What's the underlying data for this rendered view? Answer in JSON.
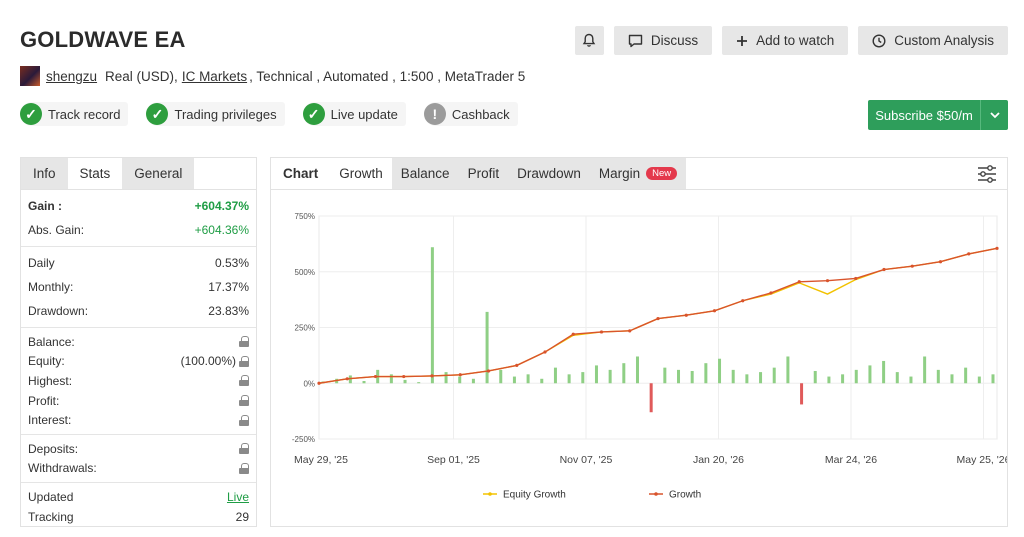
{
  "header": {
    "title": "GOLDWAVE EA",
    "bell_icon": "bell-icon",
    "discuss_label": "Discuss",
    "watch_label": "Add to watch",
    "analysis_label": "Custom Analysis"
  },
  "meta": {
    "author": "shengzu",
    "account_type": "Real (USD),",
    "broker": "IC Markets",
    "details": ", Technical , Automated , 1:500 , MetaTrader 5"
  },
  "badges": [
    {
      "label": "Track record",
      "status": "ok"
    },
    {
      "label": "Trading privileges",
      "status": "ok"
    },
    {
      "label": "Live update",
      "status": "ok"
    },
    {
      "label": "Cashback",
      "status": "unavailable"
    }
  ],
  "subscribe": {
    "label": "Subscribe $50/m"
  },
  "stats_tabs": [
    "Info",
    "Stats",
    "General"
  ],
  "stats": {
    "gain_label": "Gain :",
    "gain_value": "+604.37%",
    "abs_gain_label": "Abs. Gain:",
    "abs_gain_value": "+604.36%",
    "daily_label": "Daily",
    "daily_value": "0.53%",
    "monthly_label": "Monthly:",
    "monthly_value": "17.37%",
    "drawdown_label": "Drawdown:",
    "drawdown_value": "23.83%",
    "balance_label": "Balance:",
    "equity_label": "Equity:",
    "equity_value": "(100.00%)",
    "highest_label": "Highest:",
    "profit_label": "Profit:",
    "interest_label": "Interest:",
    "deposits_label": "Deposits:",
    "withdrawals_label": "Withdrawals:",
    "updated_label": "Updated",
    "updated_value": "Live",
    "tracking_label": "Tracking",
    "tracking_value": "29"
  },
  "chart_tabs": [
    "Chart",
    "Growth",
    "Balance",
    "Profit",
    "Drawdown",
    "Margin"
  ],
  "new_badge": "New",
  "colors": {
    "green": "#2e9e5b",
    "growth_line": "#d9542c",
    "equity_line": "#f2c200",
    "bar_pos": "#8fcf85",
    "bar_neg": "#e05a5a"
  },
  "chart_data": {
    "type": "line",
    "x_labels": [
      "May 29, '25",
      "Sep 01, '25",
      "Nov 07, '25",
      "Jan 20, '26",
      "Mar 24, '26",
      "May 25, '26"
    ],
    "y_ticks": [
      "750%",
      "500%",
      "250%",
      "0%",
      "-250%"
    ],
    "ylim": [
      -250,
      750
    ],
    "series": [
      {
        "name": "Equity Growth",
        "values": [
          0,
          20,
          30,
          30,
          33,
          38,
          55,
          80,
          140,
          215,
          230,
          235,
          290,
          305,
          325,
          370,
          400,
          450,
          400,
          465,
          510,
          525,
          545,
          580,
          605
        ]
      },
      {
        "name": "Growth",
        "values": [
          0,
          20,
          30,
          30,
          33,
          38,
          55,
          80,
          140,
          220,
          230,
          235,
          290,
          305,
          325,
          370,
          405,
          455,
          460,
          470,
          510,
          525,
          545,
          580,
          605
        ]
      }
    ],
    "bars": [
      8,
      20,
      35,
      10,
      60,
      40,
      15,
      5,
      610,
      50,
      30,
      20,
      320,
      60,
      30,
      40,
      20,
      70,
      40,
      50,
      80,
      60,
      90,
      120,
      -130,
      70,
      60,
      55,
      90,
      110,
      60,
      40,
      50,
      70,
      120,
      -95,
      55,
      30,
      40,
      60,
      80,
      100,
      50,
      30,
      120,
      60,
      40,
      70,
      30,
      40
    ],
    "legend": [
      "Equity Growth",
      "Growth"
    ]
  }
}
